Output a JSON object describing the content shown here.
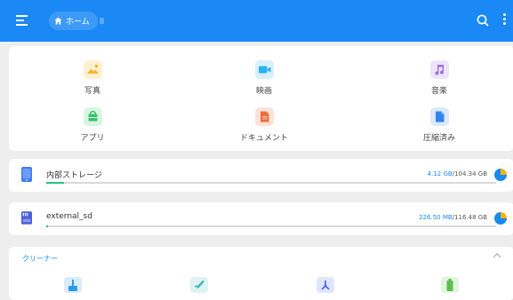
{
  "header": {
    "home_label": "ホーム",
    "accent_color": "#1a88f5",
    "icons": [
      "menu-icon",
      "home-icon",
      "search-icon",
      "more-vert-icon"
    ]
  },
  "categories": [
    {
      "label": "写真",
      "icon": "photo-icon",
      "color": "#f7b731",
      "bg": "#fdf1d2"
    },
    {
      "label": "映画",
      "icon": "video-icon",
      "color": "#2bb2ee",
      "bg": "#d8f0fb"
    },
    {
      "label": "音楽",
      "icon": "music-icon",
      "color": "#9b6ce8",
      "bg": "#ece4fb"
    },
    {
      "label": "アプリ",
      "icon": "app-icon",
      "color": "#36c26a",
      "bg": "#d9f4e3"
    },
    {
      "label": "ドキュメント",
      "icon": "document-icon",
      "color": "#f26c3b",
      "bg": "#fde2d8"
    },
    {
      "label": "圧縮済み",
      "icon": "archive-icon",
      "color": "#2f86f0",
      "bg": "#dce9fc"
    }
  ],
  "storage": [
    {
      "name": "内部ストレージ",
      "used": "4.12 GB",
      "separator": "/",
      "total": "104.34 GB",
      "used_fraction": 0.04,
      "icon": "phone-icon"
    },
    {
      "name": "external_sd",
      "used": "226.50 MB",
      "separator": "/",
      "total": "116.48 GB",
      "used_fraction": 0.002,
      "icon": "sd-card-icon"
    }
  ],
  "cleaner": {
    "title": "クリーナー",
    "icons": [
      "broom-icon",
      "rocket-icon",
      "fan-icon",
      "battery-icon"
    ]
  }
}
